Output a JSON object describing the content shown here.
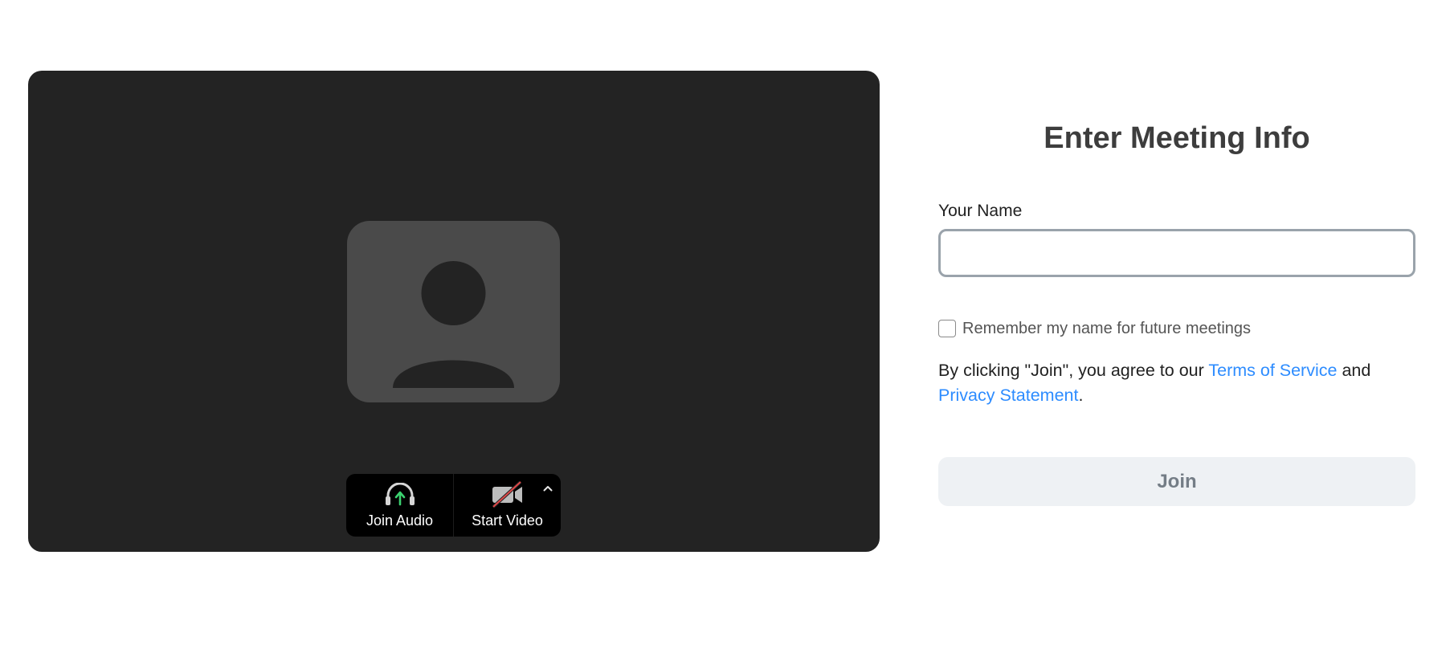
{
  "preview": {
    "controls": {
      "join_audio": {
        "label": "Join Audio",
        "icon": "headphones-arrow-up-icon",
        "accent": "#3bd16f"
      },
      "start_video": {
        "label": "Start Video",
        "icon": "video-off-icon",
        "slash_color": "#e04848"
      },
      "options_icon": "chevron-up-icon"
    },
    "avatar_icon": "user-silhouette-icon"
  },
  "form": {
    "title": "Enter Meeting Info",
    "name_label": "Your Name",
    "name_value": "",
    "remember_label": "Remember my name for future meetings",
    "remember_checked": false,
    "agree_prefix": "By clicking \"Join\", you agree to our ",
    "terms_link": "Terms of Service",
    "agree_middle": " and",
    "privacy_link": "Privacy Statement",
    "agree_suffix": ".",
    "join_button": "Join",
    "link_color": "#2d8cff"
  }
}
